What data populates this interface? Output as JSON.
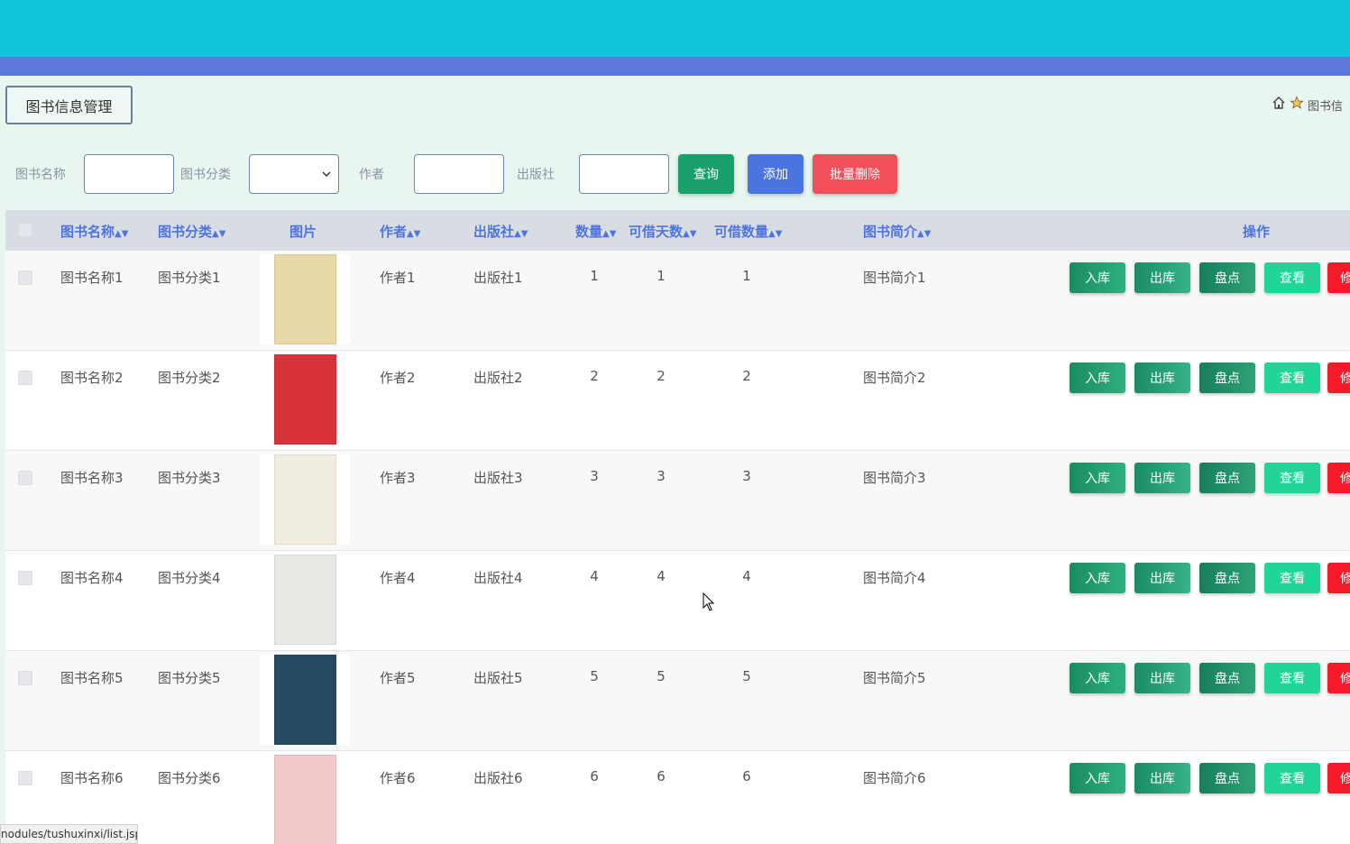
{
  "header": {
    "title": "图书信息管理"
  },
  "breadcrumb": {
    "text": "图书信"
  },
  "search": {
    "name_label": "图书名称",
    "category_label": "图书分类",
    "author_label": "作者",
    "publisher_label": "出版社",
    "name_value": "",
    "author_value": "",
    "publisher_value": "",
    "category_value": "",
    "query_label": "查询",
    "add_label": "添加",
    "batch_delete_label": "批量删除"
  },
  "table": {
    "headers": {
      "name": "图书名称",
      "category": "图书分类",
      "image": "图片",
      "author": "作者",
      "publisher": "出版社",
      "quantity": "数量",
      "borrow_days": "可借天数",
      "borrow_qty": "可借数量",
      "intro": "图书简介",
      "actions": "操作"
    },
    "actions": {
      "in": "入库",
      "out": "出库",
      "check": "盘点",
      "view": "查看",
      "edit": "修"
    },
    "rows": [
      {
        "name": "图书名称1",
        "category": "图书分类1",
        "author": "作者1",
        "publisher": "出版社1",
        "quantity": "1",
        "borrow_days": "1",
        "borrow_qty": "1",
        "intro": "图书简介1",
        "cover_color": "#e8d9a7"
      },
      {
        "name": "图书名称2",
        "category": "图书分类2",
        "author": "作者2",
        "publisher": "出版社2",
        "quantity": "2",
        "borrow_days": "2",
        "borrow_qty": "2",
        "intro": "图书简介2",
        "cover_color": "#d8333a"
      },
      {
        "name": "图书名称3",
        "category": "图书分类3",
        "author": "作者3",
        "publisher": "出版社3",
        "quantity": "3",
        "borrow_days": "3",
        "borrow_qty": "3",
        "intro": "图书简介3",
        "cover_color": "#f1ede0"
      },
      {
        "name": "图书名称4",
        "category": "图书分类4",
        "author": "作者4",
        "publisher": "出版社4",
        "quantity": "4",
        "borrow_days": "4",
        "borrow_qty": "4",
        "intro": "图书简介4",
        "cover_color": "#e9e9e6"
      },
      {
        "name": "图书名称5",
        "category": "图书分类5",
        "author": "作者5",
        "publisher": "出版社5",
        "quantity": "5",
        "borrow_days": "5",
        "borrow_qty": "5",
        "intro": "图书简介5",
        "cover_color": "#274a63"
      },
      {
        "name": "图书名称6",
        "category": "图书分类6",
        "author": "作者6",
        "publisher": "出版社6",
        "quantity": "6",
        "borrow_days": "6",
        "borrow_qty": "6",
        "intro": "图书简介6",
        "cover_color": "#f3c9cc"
      }
    ]
  },
  "statusbar": {
    "url": "nodules/tushuxinxi/list.jsp"
  },
  "colors": {
    "topbar": "#12c5da",
    "subbar": "#5b78db",
    "accent": "#4f74e0"
  }
}
